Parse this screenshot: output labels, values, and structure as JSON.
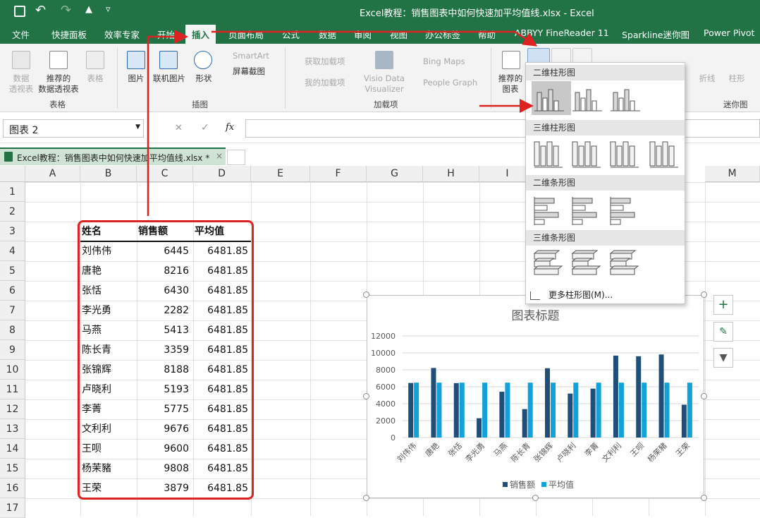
{
  "title_bar": {
    "title": "Excel教程：销售图表中如何快速加平均值线.xlsx  -  Excel"
  },
  "tabs": [
    "文件",
    "快捷面板",
    "效率专家",
    "开始",
    "插入",
    "页面布局",
    "公式",
    "数据",
    "审阅",
    "视图",
    "办公标签",
    "帮助",
    "ABBYY FineReader 11",
    "Sparkline迷你图",
    "Power Pivot"
  ],
  "ribbon": {
    "pivot": "数据\n透视表",
    "rec_pivot": "推荐的\n数据透视表",
    "table": "表格",
    "group_tables": "表格",
    "picture": "图片",
    "online_picture": "联机图片",
    "shapes": "形状",
    "smartart": "SmartArt",
    "screenshot": "屏幕截图",
    "group_illustrations": "插图",
    "get_addins": "获取加载项",
    "my_addins": "我的加载项",
    "visio": "Visio Data\nVisualizer",
    "bing": "Bing Maps",
    "people": "People Graph",
    "group_addins": "加载项",
    "rec_charts": "推荐的\n图表",
    "sparkline_line": "折线",
    "sparkline_col": "柱形",
    "group_sparklines": "迷你图"
  },
  "formula_bar": {
    "name_box": "图表 2",
    "fx": "fx",
    "cancel": "✕",
    "enter": "✓"
  },
  "doc_tab": {
    "label": "Excel教程：销售图表中如何快速加平均值线.xlsx *",
    "close": "×"
  },
  "columns": [
    "A",
    "B",
    "C",
    "D",
    "E",
    "F",
    "G",
    "H",
    "I",
    "M"
  ],
  "rows": [
    "1",
    "2",
    "3",
    "4",
    "5",
    "6",
    "7",
    "8",
    "9",
    "10",
    "11",
    "12",
    "13",
    "14",
    "15",
    "16",
    "17"
  ],
  "table": {
    "headers": [
      "姓名",
      "销售额",
      "平均值"
    ],
    "rows": [
      [
        "刘伟伟",
        "6445",
        "6481.85"
      ],
      [
        "唐艳",
        "8216",
        "6481.85"
      ],
      [
        "张恬",
        "6430",
        "6481.85"
      ],
      [
        "李光勇",
        "2282",
        "6481.85"
      ],
      [
        "马燕",
        "5413",
        "6481.85"
      ],
      [
        "陈长青",
        "3359",
        "6481.85"
      ],
      [
        "张锦辉",
        "8188",
        "6481.85"
      ],
      [
        "卢晓利",
        "5193",
        "6481.85"
      ],
      [
        "李菁",
        "5775",
        "6481.85"
      ],
      [
        "文利利",
        "9676",
        "6481.85"
      ],
      [
        "王呗",
        "9600",
        "6481.85"
      ],
      [
        "杨茉豬",
        "9808",
        "6481.85"
      ],
      [
        "王荣",
        "3879",
        "6481.85"
      ]
    ]
  },
  "dropdown": {
    "sec_2d_col": "二维柱形图",
    "sec_3d_col": "三维柱形图",
    "sec_2d_bar": "二维条形图",
    "sec_3d_bar": "三维条形图",
    "more": "更多柱形图(M)..."
  },
  "chart_data": {
    "type": "bar",
    "title": "图表标题",
    "categories": [
      "刘伟伟",
      "唐艳",
      "张恬",
      "李光勇",
      "马燕",
      "陈长青",
      "张锦辉",
      "卢晓利",
      "李菁",
      "文利利",
      "王呗",
      "杨茉豬",
      "王荣"
    ],
    "series": [
      {
        "name": "销售额",
        "values": [
          6445,
          8216,
          6430,
          2282,
          5413,
          3359,
          8188,
          5193,
          5775,
          9676,
          9600,
          9808,
          3879
        ],
        "color": "#1f4e79"
      },
      {
        "name": "平均值",
        "values": [
          6481.85,
          6481.85,
          6481.85,
          6481.85,
          6481.85,
          6481.85,
          6481.85,
          6481.85,
          6481.85,
          6481.85,
          6481.85,
          6481.85,
          6481.85
        ],
        "color": "#12a2d8"
      }
    ],
    "yticks": [
      "0",
      "2000",
      "4000",
      "6000",
      "8000",
      "10000",
      "12000"
    ],
    "ylim": [
      0,
      12000
    ],
    "legend": "bottom",
    "grid": true
  },
  "colors": {
    "brand": "#217346",
    "annotation_red": "#dd2222"
  }
}
